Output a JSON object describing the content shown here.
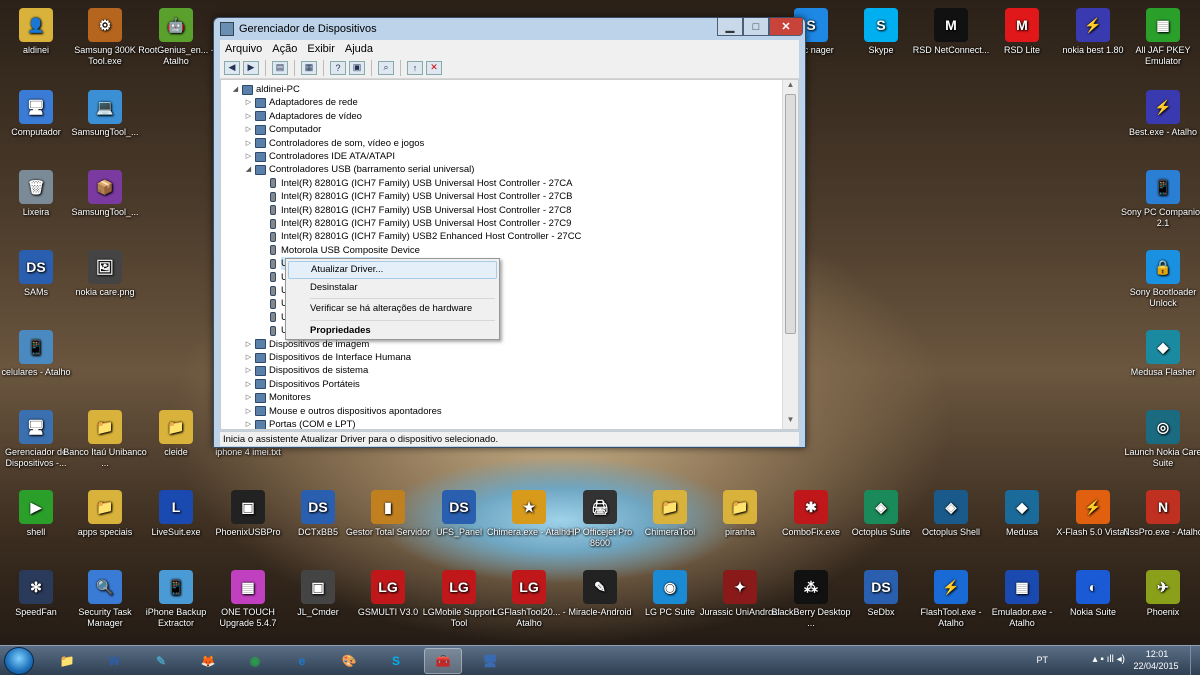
{
  "window": {
    "title": "Gerenciador de Dispositivos",
    "menu": [
      "Arquivo",
      "Ação",
      "Exibir",
      "Ajuda"
    ],
    "status": "Inicia o assistente Atualizar Driver para o dispositivo selecionado.",
    "tree": [
      {
        "label": "aldinei-PC",
        "level": 0,
        "expander": "◢"
      },
      {
        "label": "Adaptadores de rede",
        "level": 1,
        "expander": "▷"
      },
      {
        "label": "Adaptadores de vídeo",
        "level": 1,
        "expander": "▷"
      },
      {
        "label": "Computador",
        "level": 1,
        "expander": "▷"
      },
      {
        "label": "Controladores de som, vídeo e jogos",
        "level": 1,
        "expander": "▷"
      },
      {
        "label": "Controladores IDE ATA/ATAPI",
        "level": 1,
        "expander": "▷"
      },
      {
        "label": "Controladores USB (barramento serial universal)",
        "level": 1,
        "expander": "◢"
      },
      {
        "label": "Intel(R) 82801G (ICH7 Family) USB Universal Host Controller - 27CA",
        "level": 2,
        "expander": ""
      },
      {
        "label": "Intel(R) 82801G (ICH7 Family) USB Universal Host Controller - 27CB",
        "level": 2,
        "expander": ""
      },
      {
        "label": "Intel(R) 82801G (ICH7 Family) USB Universal Host Controller - 27C8",
        "level": 2,
        "expander": ""
      },
      {
        "label": "Intel(R) 82801G (ICH7 Family) USB Universal Host Controller - 27C9",
        "level": 2,
        "expander": ""
      },
      {
        "label": "Intel(R) 82801G (ICH7 Family) USB2 Enhanced Host Controller - 27CC",
        "level": 2,
        "expander": ""
      },
      {
        "label": "Motorola USB Composite Device",
        "level": 2,
        "expander": ""
      },
      {
        "label": "USB Composite Device",
        "level": 2,
        "expander": ""
      },
      {
        "label": "U",
        "level": 2,
        "expander": ""
      },
      {
        "label": "U",
        "level": 2,
        "expander": ""
      },
      {
        "label": "U",
        "level": 2,
        "expander": ""
      },
      {
        "label": "U",
        "level": 2,
        "expander": ""
      },
      {
        "label": "U",
        "level": 2,
        "expander": ""
      },
      {
        "label": "Dispositivos de imagem",
        "level": 1,
        "expander": "▷"
      },
      {
        "label": "Dispositivos de Interface Humana",
        "level": 1,
        "expander": "▷"
      },
      {
        "label": "Dispositivos de sistema",
        "level": 1,
        "expander": "▷"
      },
      {
        "label": "Dispositivos Portáteis",
        "level": 1,
        "expander": "▷"
      },
      {
        "label": "Monitores",
        "level": 1,
        "expander": "▷"
      },
      {
        "label": "Mouse e outros dispositivos apontadores",
        "level": 1,
        "expander": "▷"
      },
      {
        "label": "Portas (COM e LPT)",
        "level": 1,
        "expander": "▷"
      }
    ]
  },
  "context_menu": {
    "update_driver": "Atualizar Driver...",
    "uninstall": "Desinstalar",
    "scan": "Verificar se há alterações de hardware",
    "properties": "Propriedades"
  },
  "desktop_icons": [
    {
      "label": "aldinei",
      "color": "#d8b23a",
      "glyph": "👤"
    },
    {
      "label": "Samsung 300K Tool.exe",
      "color": "#b5651d",
      "glyph": "⚙"
    },
    {
      "label": "RootGenius_en... - Atalho",
      "color": "#5aa02c",
      "glyph": "🤖"
    },
    {
      "label": "Computador",
      "color": "#3a7bd5",
      "glyph": "🖥"
    },
    {
      "label": "SamsungTool_...",
      "color": "#3a8fd5",
      "glyph": "💻"
    },
    {
      "label": "Lixeira",
      "color": "#7a8a96",
      "glyph": "🗑"
    },
    {
      "label": "SamsungTool_...",
      "color": "#7a3aa0",
      "glyph": "📦"
    },
    {
      "label": "SAMs",
      "color": "#2a5fb0",
      "glyph": "DS"
    },
    {
      "label": "nokia care.png",
      "color": "#444",
      "glyph": "🖼"
    },
    {
      "label": "celulares - Atalho",
      "color": "#4a8ac0",
      "glyph": "📱"
    },
    {
      "label": "Gerenciador de Dispositivos -...",
      "color": "#3a6fb0",
      "glyph": "🖥"
    },
    {
      "label": "Banco Itaú Unibanco ...",
      "color": "#d8b23a",
      "glyph": "📁"
    },
    {
      "label": "cleide",
      "color": "#d8b23a",
      "glyph": "📁"
    },
    {
      "label": "iphone 4 imei.txt",
      "color": "#ccc",
      "glyph": "📄"
    },
    {
      "label": "Sync nager",
      "color": "#1e88e5",
      "glyph": "S"
    },
    {
      "label": "Skype",
      "color": "#00aff0",
      "glyph": "S"
    },
    {
      "label": "RSD NetConnect...",
      "color": "#111",
      "glyph": "M"
    },
    {
      "label": "RSD Lite",
      "color": "#e0181a",
      "glyph": "M"
    },
    {
      "label": "nokia best 1.80",
      "color": "#3a3ab0",
      "glyph": "⚡"
    },
    {
      "label": "All JAF PKEY Emulator",
      "color": "#2aa02a",
      "glyph": "▦"
    },
    {
      "label": "Best.exe - Atalho",
      "color": "#3a3ab0",
      "glyph": "⚡"
    },
    {
      "label": "Sony PC Companion 2.1",
      "color": "#2a7fd5",
      "glyph": "📱"
    },
    {
      "label": "Sony Bootloader Unlock",
      "color": "#1a90e0",
      "glyph": "🔒"
    },
    {
      "label": "Medusa Flasher",
      "color": "#1a8aa0",
      "glyph": "◆"
    },
    {
      "label": "Launch Nokia Care Suite",
      "color": "#1a6a80",
      "glyph": "◎"
    },
    {
      "label": "shell",
      "color": "#2aa02a",
      "glyph": "▶"
    },
    {
      "label": "apps speciais",
      "color": "#d8b23a",
      "glyph": "📁"
    },
    {
      "label": "LiveSuit.exe",
      "color": "#1a4ab0",
      "glyph": "L"
    },
    {
      "label": "PhoenixUSBPro",
      "color": "#222",
      "glyph": "▣"
    },
    {
      "label": "DCTxBB5",
      "color": "#2a5fb0",
      "glyph": "DS"
    },
    {
      "label": "Gestor Total Servidor",
      "color": "#c08020",
      "glyph": "▮"
    },
    {
      "label": "UFS_Panel",
      "color": "#2a5fb0",
      "glyph": "DS"
    },
    {
      "label": "Chimera.exe - Atalho",
      "color": "#d89a1a",
      "glyph": "★"
    },
    {
      "label": "HP Officejet Pro 8600",
      "color": "#333",
      "glyph": "🖨"
    },
    {
      "label": "ChimeraTool",
      "color": "#d8b23a",
      "glyph": "📁"
    },
    {
      "label": "piranha",
      "color": "#d8b23a",
      "glyph": "📁"
    },
    {
      "label": "ComboFix.exe",
      "color": "#c0181a",
      "glyph": "✱"
    },
    {
      "label": "Octoplus Suite",
      "color": "#1a8a5a",
      "glyph": "◈"
    },
    {
      "label": "Octoplus Shell",
      "color": "#1a5a8a",
      "glyph": "◈"
    },
    {
      "label": "Medusa",
      "color": "#1a6a9a",
      "glyph": "◆"
    },
    {
      "label": "X-Flash 5.0 Vista7",
      "color": "#e06010",
      "glyph": "⚡"
    },
    {
      "label": "NssPro.exe - Atalho",
      "color": "#c03020",
      "glyph": "N"
    },
    {
      "label": "SpeedFan",
      "color": "#2a3a5a",
      "glyph": "✻"
    },
    {
      "label": "Security Task Manager",
      "color": "#3a7bd5",
      "glyph": "🔍"
    },
    {
      "label": "iPhone Backup Extractor",
      "color": "#4a9ad5",
      "glyph": "📱"
    },
    {
      "label": "ONE TOUCH Upgrade 5.4.7",
      "color": "#c040c0",
      "glyph": "▦"
    },
    {
      "label": "JL_Cmder",
      "color": "#444",
      "glyph": "▣"
    },
    {
      "label": "GSMULTI V3.0",
      "color": "#c0181a",
      "glyph": "LG"
    },
    {
      "label": "LGMobile Support Tool",
      "color": "#c0181a",
      "glyph": "LG"
    },
    {
      "label": "LGFlashTool20... - Atalho",
      "color": "#c0181a",
      "glyph": "LG"
    },
    {
      "label": "Miracle-Android",
      "color": "#222",
      "glyph": "✎"
    },
    {
      "label": "LG PC Suite",
      "color": "#1a8ad5",
      "glyph": "◉"
    },
    {
      "label": "Jurassic UniAndroid",
      "color": "#8a1a1a",
      "glyph": "✦"
    },
    {
      "label": "BlackBerry Desktop ...",
      "color": "#111",
      "glyph": "⁂"
    },
    {
      "label": "SeDbx",
      "color": "#2a5fb0",
      "glyph": "DS"
    },
    {
      "label": "FlashTool.exe - Atalho",
      "color": "#1a6ad5",
      "glyph": "⚡"
    },
    {
      "label": "Emulador.exe - Atalho",
      "color": "#1a4ab0",
      "glyph": "▦"
    },
    {
      "label": "Nokia Suite",
      "color": "#1a5ad5",
      "glyph": "◐"
    },
    {
      "label": "Phoenix",
      "color": "#8aa01a",
      "glyph": "✈"
    }
  ],
  "taskbar": {
    "apps": [
      "📁",
      "W",
      "✎",
      "🦊",
      "◉",
      "e",
      "🎨",
      "S",
      "🧰",
      "🖥"
    ],
    "lang": "PT",
    "time": "12:01",
    "date": "22/04/2015"
  }
}
